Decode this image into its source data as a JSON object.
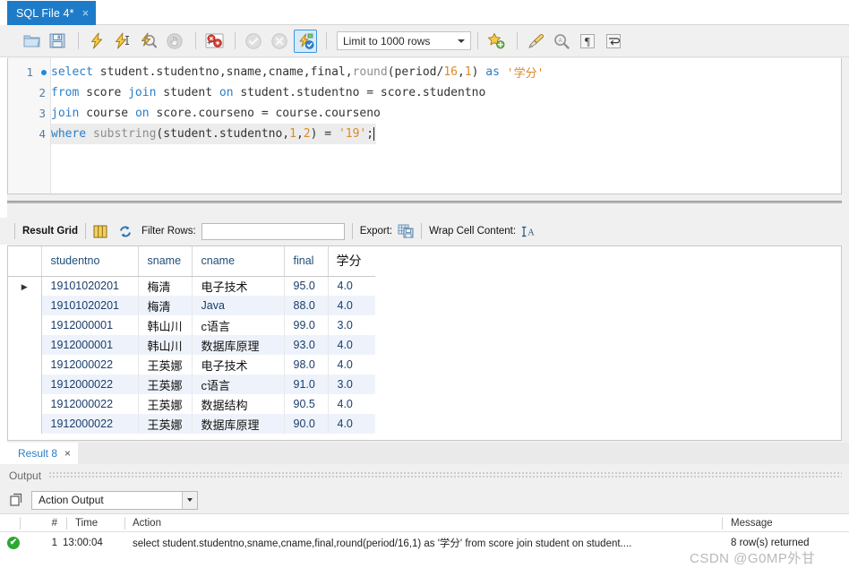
{
  "window": {
    "tab": {
      "label": "SQL File 4*",
      "close": "×"
    }
  },
  "toolbar": {
    "icons": [
      {
        "name": "open-sql-file-icon",
        "title": "Open SQL Script File"
      },
      {
        "name": "save-sql-file-icon",
        "title": "Save Script File"
      },
      {
        "name": "execute-statement-icon",
        "title": "Execute"
      },
      {
        "name": "execute-current-statement-icon",
        "title": "Execute Current Statement"
      },
      {
        "name": "explain-query-icon",
        "title": "Explain Current Statement"
      },
      {
        "name": "stop-query-icon",
        "title": "Stop"
      },
      {
        "name": "toggle-stop-on-error-icon",
        "title": "Toggle whether execution should stop on errors"
      },
      {
        "name": "commit-icon",
        "title": "Commit"
      },
      {
        "name": "rollback-icon",
        "title": "Rollback"
      },
      {
        "name": "toggle-autocommit-icon",
        "title": "Toggle Auto-Commit"
      },
      {
        "name": "save-snippet-icon",
        "title": "Save current statement to snippets"
      },
      {
        "name": "beautify-query-icon",
        "title": "Beautify/reformat the SQL script"
      },
      {
        "name": "find-icon",
        "title": "Show the Find panel"
      },
      {
        "name": "toggle-invisible-chars-icon",
        "title": "Toggle invisible characters"
      },
      {
        "name": "wrap-lines-icon",
        "title": "Wrap long lines"
      }
    ],
    "limit_select": {
      "value": "Limit to 1000 rows"
    }
  },
  "editor": {
    "lines": [
      {
        "number": "1",
        "has_breakpoint_dot": true,
        "tokens": [
          {
            "t": "select ",
            "c": "kw"
          },
          {
            "t": "student.studentno,sname,cname,final,",
            "c": "id"
          },
          {
            "t": "round",
            "c": "fn"
          },
          {
            "t": "(period/",
            "c": "op"
          },
          {
            "t": "16",
            "c": "num"
          },
          {
            "t": ",",
            "c": "op"
          },
          {
            "t": "1",
            "c": "num"
          },
          {
            "t": ") ",
            "c": "op"
          },
          {
            "t": "as ",
            "c": "kw"
          },
          {
            "t": "'学分'",
            "c": "str"
          }
        ]
      },
      {
        "number": "2",
        "has_breakpoint_dot": false,
        "tokens": [
          {
            "t": "from ",
            "c": "kw"
          },
          {
            "t": "score ",
            "c": "id"
          },
          {
            "t": "join ",
            "c": "kw"
          },
          {
            "t": "student ",
            "c": "id"
          },
          {
            "t": "on ",
            "c": "kw"
          },
          {
            "t": "student.studentno = score.studentno",
            "c": "id"
          }
        ]
      },
      {
        "number": "3",
        "has_breakpoint_dot": false,
        "tokens": [
          {
            "t": "join ",
            "c": "kw"
          },
          {
            "t": "course ",
            "c": "id"
          },
          {
            "t": "on ",
            "c": "kw"
          },
          {
            "t": "score.courseno = course.courseno",
            "c": "id"
          }
        ]
      },
      {
        "number": "4",
        "has_breakpoint_dot": false,
        "highlight": true,
        "tokens": [
          {
            "t": "where ",
            "c": "kw"
          },
          {
            "t": "substring",
            "c": "fn"
          },
          {
            "t": "(student.studentno,",
            "c": "op"
          },
          {
            "t": "1",
            "c": "num"
          },
          {
            "t": ",",
            "c": "op"
          },
          {
            "t": "2",
            "c": "num"
          },
          {
            "t": ") = ",
            "c": "op"
          },
          {
            "t": "'19'",
            "c": "str"
          },
          {
            "t": ";",
            "c": "op"
          }
        ]
      }
    ]
  },
  "result_toolbar": {
    "result_grid_label": "Result Grid",
    "grid_view_icon": "grid-view-icon",
    "refresh_icon": "refresh-icon",
    "filter_label": "Filter Rows:",
    "filter_value": "",
    "filter_placeholder": "",
    "export_label": "Export:",
    "export_icon": "export-recordset-icon",
    "wrap_label": "Wrap Cell Content:",
    "wrap_icon": "wrap-cell-content-icon"
  },
  "grid": {
    "columns": [
      "studentno",
      "sname",
      "cname",
      "final",
      "学分"
    ],
    "rows": [
      {
        "selected": true,
        "cells": [
          "19101020201",
          "梅清",
          "电子技术",
          "95.0",
          "4.0"
        ]
      },
      {
        "selected": false,
        "cells": [
          "19101020201",
          "梅清",
          "Java",
          "88.0",
          "4.0"
        ]
      },
      {
        "selected": false,
        "cells": [
          "1912000001",
          "韩山川",
          "c语言",
          "99.0",
          "3.0"
        ]
      },
      {
        "selected": false,
        "cells": [
          "1912000001",
          "韩山川",
          "数据库原理",
          "93.0",
          "4.0"
        ]
      },
      {
        "selected": false,
        "cells": [
          "1912000022",
          "王英娜",
          "电子技术",
          "98.0",
          "4.0"
        ]
      },
      {
        "selected": false,
        "cells": [
          "1912000022",
          "王英娜",
          "c语言",
          "91.0",
          "3.0"
        ]
      },
      {
        "selected": false,
        "cells": [
          "1912000022",
          "王英娜",
          "数据结构",
          "90.5",
          "4.0"
        ]
      },
      {
        "selected": false,
        "cells": [
          "1912000022",
          "王英娜",
          "数据库原理",
          "90.0",
          "4.0"
        ]
      }
    ]
  },
  "result_tab": {
    "label": "Result 8",
    "close": "×"
  },
  "output": {
    "title": "Output",
    "action_select_value": "Action Output",
    "snippets_icon": "output-pane-icon",
    "columns": {
      "num": "#",
      "time": "Time",
      "action": "Action",
      "message": "Message"
    },
    "rows": [
      {
        "status": "success",
        "status_glyph": "✔",
        "num": "1",
        "time": "13:00:04",
        "action": "select student.studentno,sname,cname,final,round(period/16,1) as '学分' from score join student on student....",
        "message": "8 row(s) returned"
      }
    ]
  },
  "watermark": {
    "text": "CSDN @G0MP外甘"
  },
  "colors": {
    "tab_active": "#1e7bc8",
    "keyword": "#2a7fc9",
    "string": "#d98a2b",
    "grid_alt_row": "#eef3fb",
    "success": "#2aa832"
  }
}
